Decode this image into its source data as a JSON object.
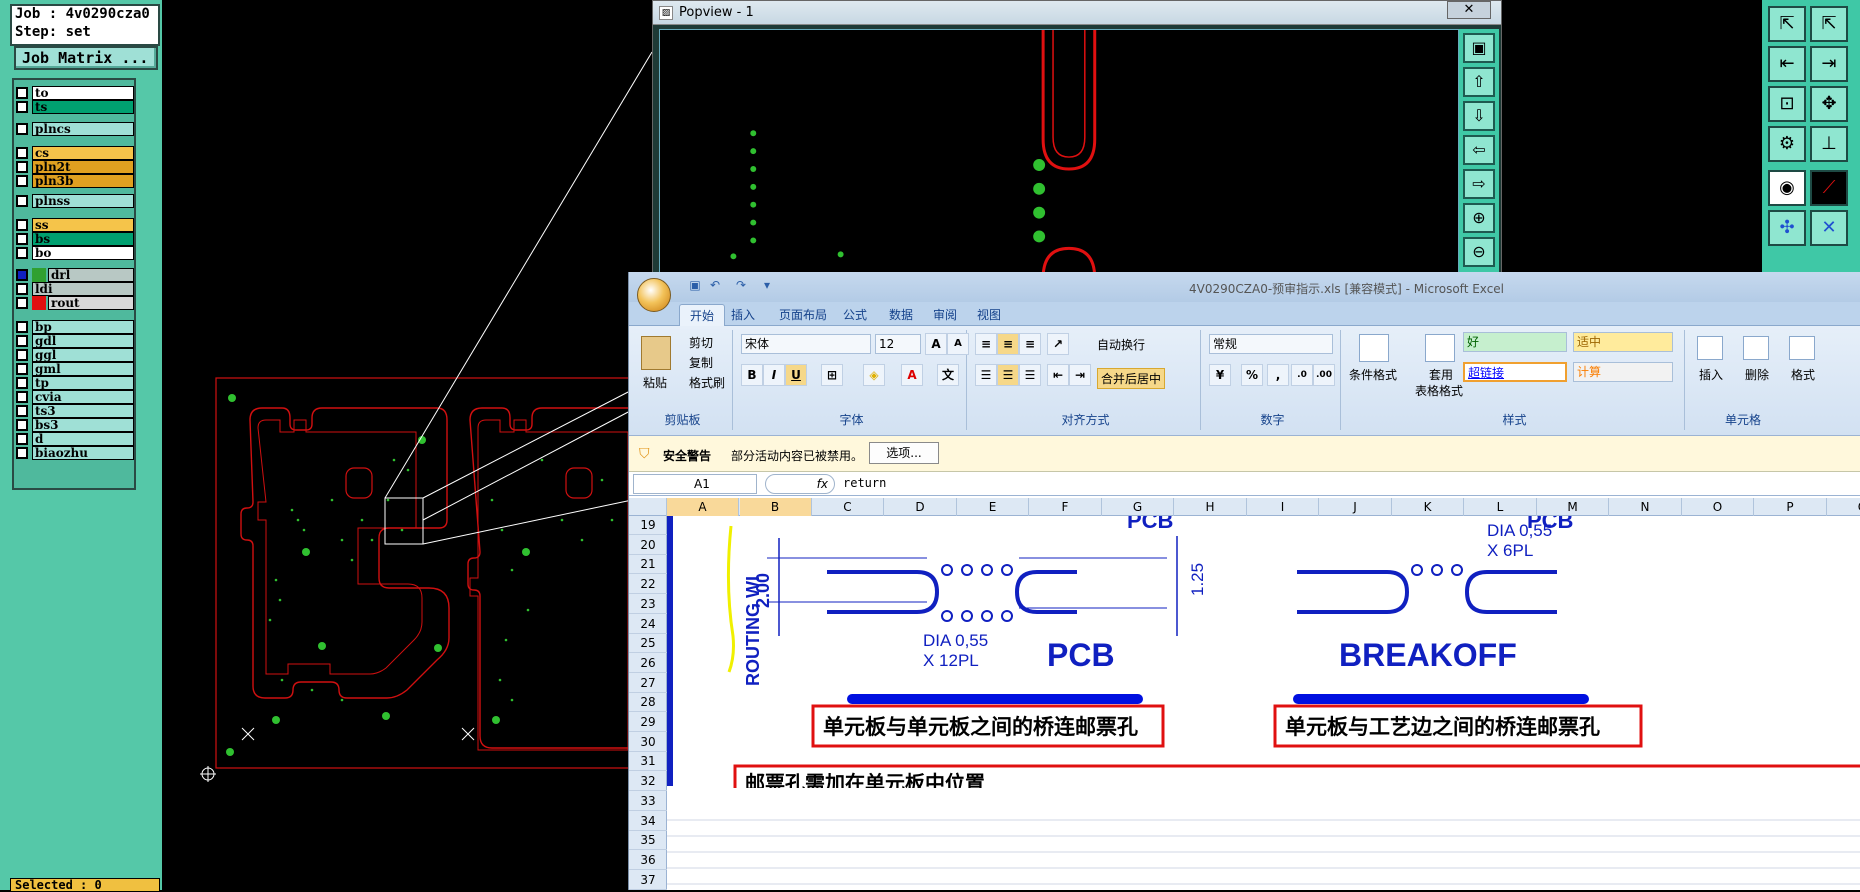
{
  "genesis": {
    "job_label": "Job : 4v0290cza0",
    "step_label": "Step: set",
    "job_matrix_button": "Job Matrix ...",
    "selected_label": "Selected : 0",
    "layers": [
      {
        "name": "to",
        "color": "#ffffff"
      },
      {
        "name": "ts",
        "color": "#00a070"
      },
      {
        "name": "plncs",
        "color": "#9fe0d6"
      },
      {
        "name": "cs",
        "color": "#f5c44a"
      },
      {
        "name": "pln2t",
        "color": "#e0a020"
      },
      {
        "name": "pln3b",
        "color": "#e0a020"
      },
      {
        "name": "plnss",
        "color": "#9fe0d6"
      },
      {
        "name": "ss",
        "color": "#f5c44a"
      },
      {
        "name": "bs",
        "color": "#00a070"
      },
      {
        "name": "bo",
        "color": "#ffffff"
      },
      {
        "name": "drl",
        "color": "#b8c8c4"
      },
      {
        "name": "ldi",
        "color": "#b8c8c4"
      },
      {
        "name": "rout",
        "color": "#d8d8d8"
      },
      {
        "name": "bp",
        "color": "#9fe0d6"
      },
      {
        "name": "gdl",
        "color": "#9fe0d6"
      },
      {
        "name": "ggl",
        "color": "#9fe0d6"
      },
      {
        "name": "gml",
        "color": "#9fe0d6"
      },
      {
        "name": "tp",
        "color": "#9fe0d6"
      },
      {
        "name": "cvia",
        "color": "#9fe0d6"
      },
      {
        "name": "ts3",
        "color": "#9fe0d6"
      },
      {
        "name": "bs3",
        "color": "#9fe0d6"
      },
      {
        "name": "d",
        "color": "#9fe0d6"
      },
      {
        "name": "biaozhu",
        "color": "#9fe0d6"
      }
    ],
    "colors": {
      "panel": "#55c8a8",
      "rout_line": "#e01010",
      "via_dot": "#30c030"
    }
  },
  "popview": {
    "title": "Popview - 1",
    "close_label": "✕"
  },
  "excel": {
    "title": "4V0290CZA0-预审指示.xls  [兼容模式]  -  Microsoft Excel",
    "tabs": [
      "开始",
      "插入",
      "页面布局",
      "公式",
      "数据",
      "审阅",
      "视图"
    ],
    "ribbon": {
      "paste": "粘贴",
      "cut": "剪切",
      "copy": "复制",
      "format_painter": "格式刷",
      "clipboard_group": "剪贴板",
      "font_name": "宋体",
      "font_size": "12",
      "font_group": "字体",
      "wrap_text": "自动换行",
      "merge_center": "合并后居中",
      "alignment_group": "对齐方式",
      "number_format": "常规",
      "number_group": "数字",
      "conditional_format": "条件格式",
      "table_format_1": "套用",
      "table_format_2": "表格格式",
      "style_good": "好",
      "style_neutral": "适中",
      "style_hyperlink": "超链接",
      "style_calc": "计算",
      "styles_group": "样式",
      "insert": "插入",
      "delete": "删除",
      "format": "格式",
      "cells_group": "单元格"
    },
    "security_warning": "安全警告",
    "security_message": "部分活动内容已被禁用。",
    "options_button": "选项...",
    "name_box": "A1",
    "fx": "fx",
    "formula_value": "return",
    "columns": [
      "A",
      "B",
      "C",
      "D",
      "E",
      "F",
      "G",
      "H",
      "I",
      "J",
      "K",
      "L",
      "M",
      "N",
      "O",
      "P",
      "Q"
    ],
    "rows": [
      "19",
      "20",
      "21",
      "22",
      "23",
      "24",
      "25",
      "26",
      "27",
      "28",
      "29",
      "30",
      "31",
      "32",
      "33",
      "34",
      "35",
      "36",
      "37"
    ],
    "diagram": {
      "pcb_top": "PCB",
      "pcb_top_right": "PCB",
      "dim_200": "2.00",
      "dim_125": "1.25",
      "routing_label": "ROUTING WI",
      "dia_12": "DIA 0,55",
      "x12pl": "X 12PL",
      "dia_6": "DIA 0,55",
      "x6pl": "X 6PL",
      "pcb_label": "PCB",
      "breakoff_label": "BREAKOFF",
      "bridge_left": "单元板与单元板之间的桥连邮票孔",
      "bridge_right": "单元板与工艺边之间的桥连邮票孔",
      "bottom_note": "邮票孔需加在单元板中位置"
    }
  }
}
